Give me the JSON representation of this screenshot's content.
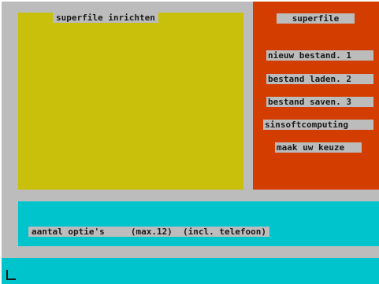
{
  "left_panel": {
    "title": "superfile inrichten"
  },
  "right_panel": {
    "title": "superfile",
    "menu": [
      {
        "label": "nieuw bestand. 1"
      },
      {
        "label": "bestand laden. 2"
      },
      {
        "label": "bestand saven. 3"
      },
      {
        "label": "sinsoftcomputing"
      }
    ],
    "prompt": "maak uw keuze"
  },
  "bottom_panel": {
    "options_text": "aantal optie's     (max.12)  (incl. telefoon)"
  },
  "colors": {
    "frame": "#bcbcbc",
    "yellow_panel": "#c8c00a",
    "red_panel": "#d33e00",
    "cyan_panel": "#00c4cc"
  }
}
